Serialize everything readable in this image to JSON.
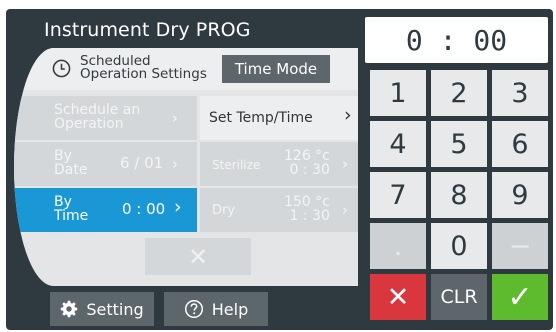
{
  "title": "Instrument Dry PROG",
  "schedule_header": {
    "label_line1": "Scheduled",
    "label_line2": "Operation Settings",
    "mode_button": "Time Mode"
  },
  "rows": {
    "schedule_op": {
      "line1": "Schedule an",
      "line2": "Operation",
      "chevron": "›"
    },
    "set_temp": {
      "label": "Set Temp/Time",
      "chevron": "›"
    },
    "by_date": {
      "line1": "By",
      "line2": "Date",
      "value": "6 / 01",
      "chevron": "›"
    },
    "sterilize": {
      "label": "Sterilize",
      "value1": "126 °c",
      "value2": "0 : 30",
      "chevron": "›"
    },
    "by_time": {
      "line1": "By",
      "line2": "Time",
      "value": "0 : 00",
      "chevron": "›"
    },
    "dry": {
      "label": "Dry",
      "value1": "150 °c",
      "value2": "1 : 30",
      "chevron": "›"
    }
  },
  "cancel_glyph": "✕",
  "bottom": {
    "setting": "Setting",
    "help": "Help"
  },
  "display": "0 : 00",
  "keys": {
    "k1": "1",
    "k2": "2",
    "k3": "3",
    "k4": "4",
    "k5": "5",
    "k6": "6",
    "k7": "7",
    "k8": "8",
    "k9": "9",
    "dot": ".",
    "k0": "0",
    "minus": "−",
    "cancel": "✕",
    "clr": "CLR",
    "ok": "✓"
  },
  "colors": {
    "frame": "#2f3a40",
    "selected": "#1a98d5",
    "button_dark": "#5d666b",
    "cancel_red": "#d9363e",
    "confirm_green": "#5fbb2e"
  },
  "icons": [
    "clock-icon",
    "gear-icon",
    "help-icon",
    "chevron-right-icon",
    "close-icon",
    "check-icon"
  ]
}
